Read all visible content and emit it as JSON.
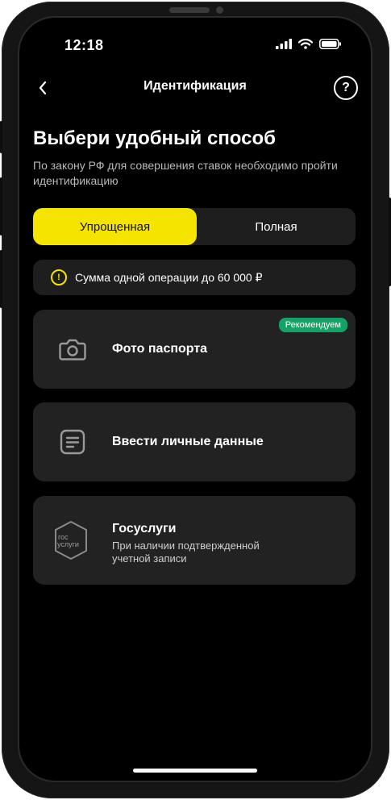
{
  "status_bar": {
    "time": "12:18"
  },
  "nav": {
    "title": "Идентификация",
    "help": "?"
  },
  "headline": "Выбери удобный способ",
  "subtext": "По закону РФ для совершения ставок необходимо пройти идентификацию",
  "segmented": {
    "simple": "Упрощенная",
    "full": "Полная"
  },
  "notice": {
    "text": "Сумма одной операции до 60 000 ₽",
    "icon": "!"
  },
  "options": [
    {
      "title": "Фото паспорта",
      "badge": "Рекомендуем",
      "icon": "camera-icon"
    },
    {
      "title": "Ввести личные данные",
      "icon": "document-icon"
    },
    {
      "title": "Госуслуги",
      "subtitle": "При наличии подтвержденной учетной записи",
      "icon": "gosuslugi-icon",
      "icon_text_top": "гос",
      "icon_text_bottom": "услуги"
    }
  ],
  "colors": {
    "accent": "#f4e400",
    "badge": "#14a367",
    "card": "#222222",
    "background": "#000000"
  }
}
